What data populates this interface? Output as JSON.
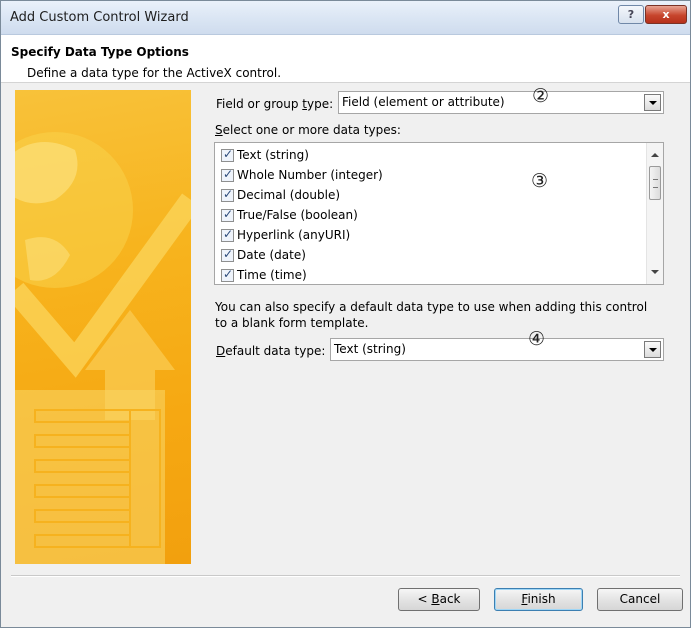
{
  "window": {
    "title": "Add Custom Control Wizard",
    "help_label": "?",
    "close_label": "x"
  },
  "header": {
    "title": "Specify Data Type Options",
    "subtitle": "Define a data type for the ActiveX control."
  },
  "field_group": {
    "label_pre": "Field or group ",
    "label_key": "t",
    "label_post": "ype:",
    "value": "Field (element or attribute)"
  },
  "data_types": {
    "label_key": "S",
    "label_rest": "elect one or more data types:",
    "items": [
      {
        "label": "Text (string)",
        "checked": true
      },
      {
        "label": "Whole Number (integer)",
        "checked": true
      },
      {
        "label": "Decimal (double)",
        "checked": true
      },
      {
        "label": "True/False (boolean)",
        "checked": true
      },
      {
        "label": "Hyperlink (anyURI)",
        "checked": true
      },
      {
        "label": "Date (date)",
        "checked": true
      },
      {
        "label": "Time (time)",
        "checked": true
      }
    ]
  },
  "default_type": {
    "info_line1": "You can also specify a default data type to use when adding this control",
    "info_line2": "to a blank form template.",
    "label_key": "D",
    "label_rest": "efault data type:",
    "value": "Text (string)"
  },
  "annotations": [
    "②",
    "③",
    "④"
  ],
  "buttons": {
    "back_pre": "< ",
    "back_key": "B",
    "back_rest": "ack",
    "finish_key": "F",
    "finish_rest": "inish",
    "cancel": "Cancel"
  },
  "colors": {
    "art_orange": "#f6a812",
    "art_yellow": "#f9d24a",
    "focus_blue": "#3c7fb1"
  }
}
